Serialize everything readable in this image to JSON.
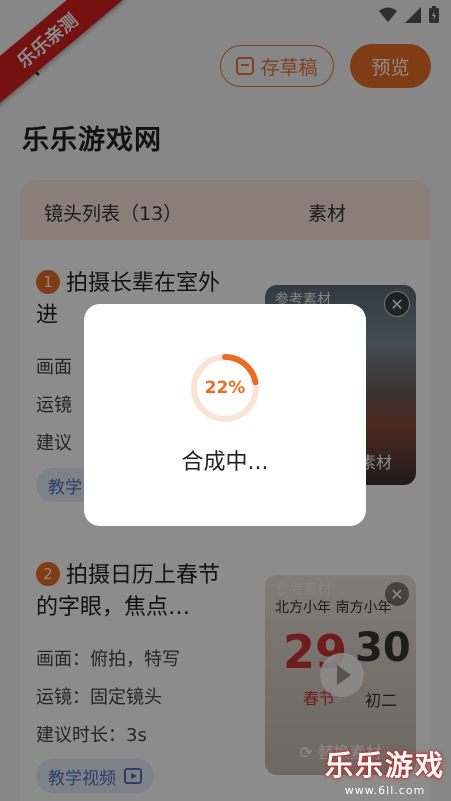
{
  "header": {
    "draft_label": "存草稿",
    "preview_label": "预览"
  },
  "page": {
    "title": "乐乐游戏网"
  },
  "card": {
    "list_header": "镜头列表（13）",
    "material_header": "素材"
  },
  "shots": [
    {
      "number": "1",
      "title": "拍摄长辈在室外进",
      "meta": [
        "画面",
        "运镜",
        "建议"
      ],
      "tutorial": "教学",
      "thumb": {
        "ref_label": "参考素材",
        "replace": "素材"
      }
    },
    {
      "number": "2",
      "title": "拍摄日历上春节的字眼，焦点…",
      "meta": [
        "画面：俯拍，特写",
        "运镜：固定镜头",
        "建议时长：3s"
      ],
      "tutorial": "教学视频",
      "thumb": {
        "ref_label": "参考素材",
        "replace": "替换素材",
        "cal_top": "北方小年  南方小年",
        "cal_big": "29",
        "cal_right": "30",
        "cal_sub": "春节",
        "cal_sub2": "初二"
      }
    }
  ],
  "dialog": {
    "progress": 22,
    "progress_text": "22%",
    "message": "合成中..."
  },
  "watermark": {
    "ribbon": "乐乐亲测",
    "brand": "乐乐游戏",
    "url": "www.6ll.com"
  },
  "colors": {
    "accent": "#ea6d25",
    "header_bg": "#fbe6dc",
    "tutorial_text": "#5670b8"
  }
}
